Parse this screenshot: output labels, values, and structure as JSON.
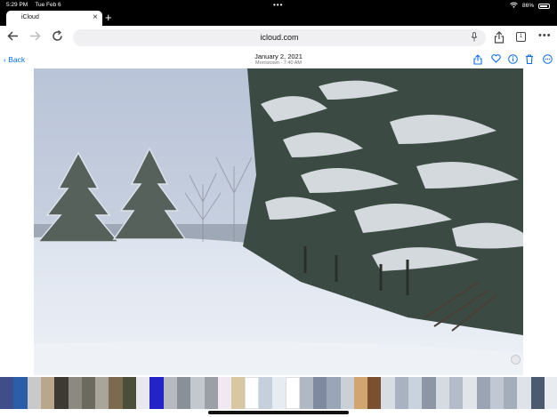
{
  "status_bar": {
    "time": "5:29 PM",
    "date": "Tue Feb 6",
    "multitask_dots": "•••",
    "battery": "86%",
    "wifi_icon": "wifi-icon",
    "battery_icon": "battery-icon"
  },
  "browser": {
    "tab": {
      "title": "iCloud",
      "close_icon": "close-icon",
      "favicon": "apple-icon"
    },
    "new_tab_icon": "plus-icon",
    "url": "icloud.com",
    "tab_count": "1",
    "nav_icons": [
      "back-arrow-icon",
      "forward-arrow-icon",
      "reload-icon",
      "microphone-icon",
      "share-icon",
      "tabs-icon",
      "more-icon"
    ]
  },
  "photo_viewer": {
    "back_label": "Back",
    "date": "January 2, 2021",
    "location_time": "Morristown · 7:40 AM",
    "action_icons": [
      "share-icon",
      "heart-icon",
      "info-icon",
      "trash-icon",
      "more-options-icon"
    ]
  },
  "filmstrip": {
    "colors": [
      "#3f4d8a",
      "#2a5ea8",
      "#c9c9c9",
      "#b8a78a",
      "#3d3a34",
      "#8c8a80",
      "#6c6a5e",
      "#a9a59a",
      "#7c6a4e",
      "#4b4f3a",
      "#e8e8ee",
      "#2323c8",
      "#b6b9c0",
      "#8a9098",
      "#c3c7ce",
      "#9aa0a6",
      "#f1e8f2",
      "#d8c7a0",
      "#ffffff",
      "#c6d0dc",
      "#e6ecf2",
      "#ffffff",
      "#b0b8c4",
      "#7f8aa0",
      "#9aa6b8",
      "#c9d0d8",
      "#d2a56e",
      "#7a5030",
      "#d8dde4",
      "#a8b2c0",
      "#c9d3de",
      "#8d96a4",
      "#d6dbe2",
      "#b3bcc8",
      "#e1e5ea",
      "#9aa4b2",
      "#c0c8d4",
      "#a4adba",
      "#dfe3e9",
      "#4c5a70",
      "#e8ebef"
    ]
  }
}
